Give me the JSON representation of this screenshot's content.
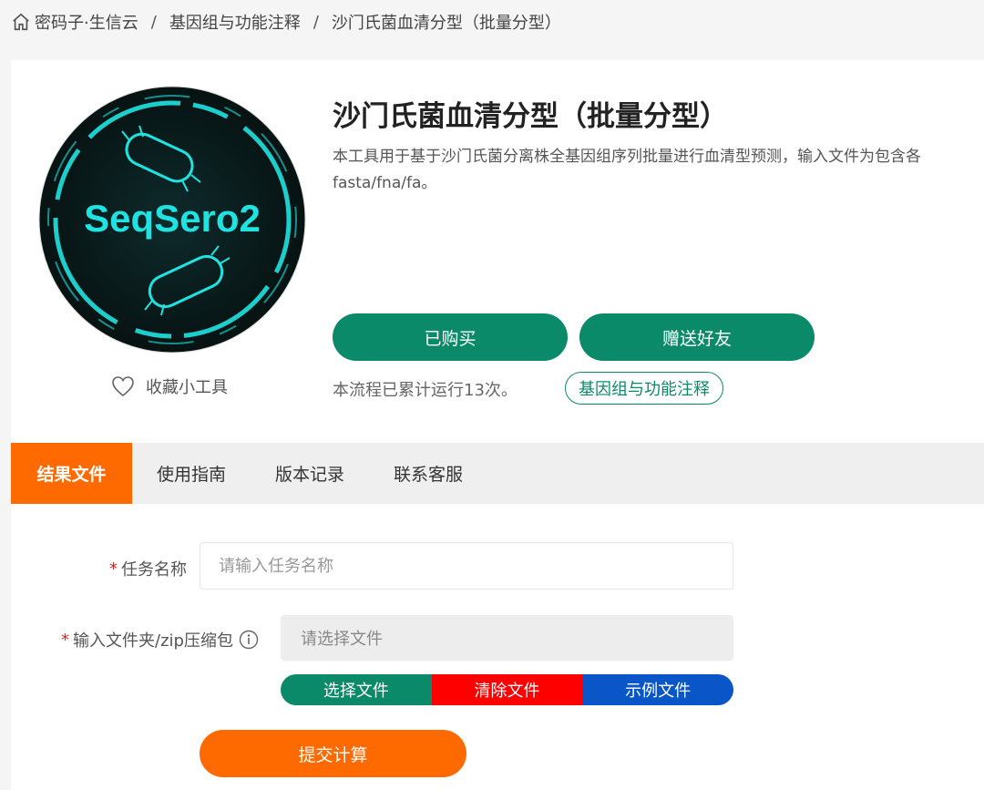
{
  "breadcrumb": {
    "items": [
      "密码子·生信云",
      "基因组与功能注释",
      "沙门氏菌血清分型（批量分型）"
    ],
    "separator": "/"
  },
  "tool": {
    "logo_text": "SeqSero2",
    "title": "沙门氏菌血清分型（批量分型）",
    "description_line1": "本工具用于基于沙门氏菌分离株全基因组序列批量进行血清型预测，输入文件为包含各",
    "description_line2": "fasta/fna/fa。",
    "favorite_label": "收藏小工具",
    "bought_label": "已购买",
    "gift_label": "赠送好友",
    "run_count_text": "本流程已累计运行13次。",
    "category_tag": "基因组与功能注释"
  },
  "tabs": [
    {
      "label": "结果文件",
      "active": true
    },
    {
      "label": "使用指南",
      "active": false
    },
    {
      "label": "版本记录",
      "active": false
    },
    {
      "label": "联系客服",
      "active": false
    }
  ],
  "form": {
    "required_mark": "*",
    "task_name_label": "任务名称",
    "task_name_placeholder": "请输入任务名称",
    "task_name_value": "",
    "input_label": "输入文件夹/zip压缩包",
    "input_placeholder": "请选择文件",
    "select_file": "选择文件",
    "clear_file": "清除文件",
    "sample_file": "示例文件",
    "submit": "提交计算"
  },
  "colors": {
    "green": "#0b8a6a",
    "orange": "#ff6a00",
    "red": "#ff0000",
    "blue": "#0a56c8",
    "logo_cyan": "#1fe3e0"
  }
}
